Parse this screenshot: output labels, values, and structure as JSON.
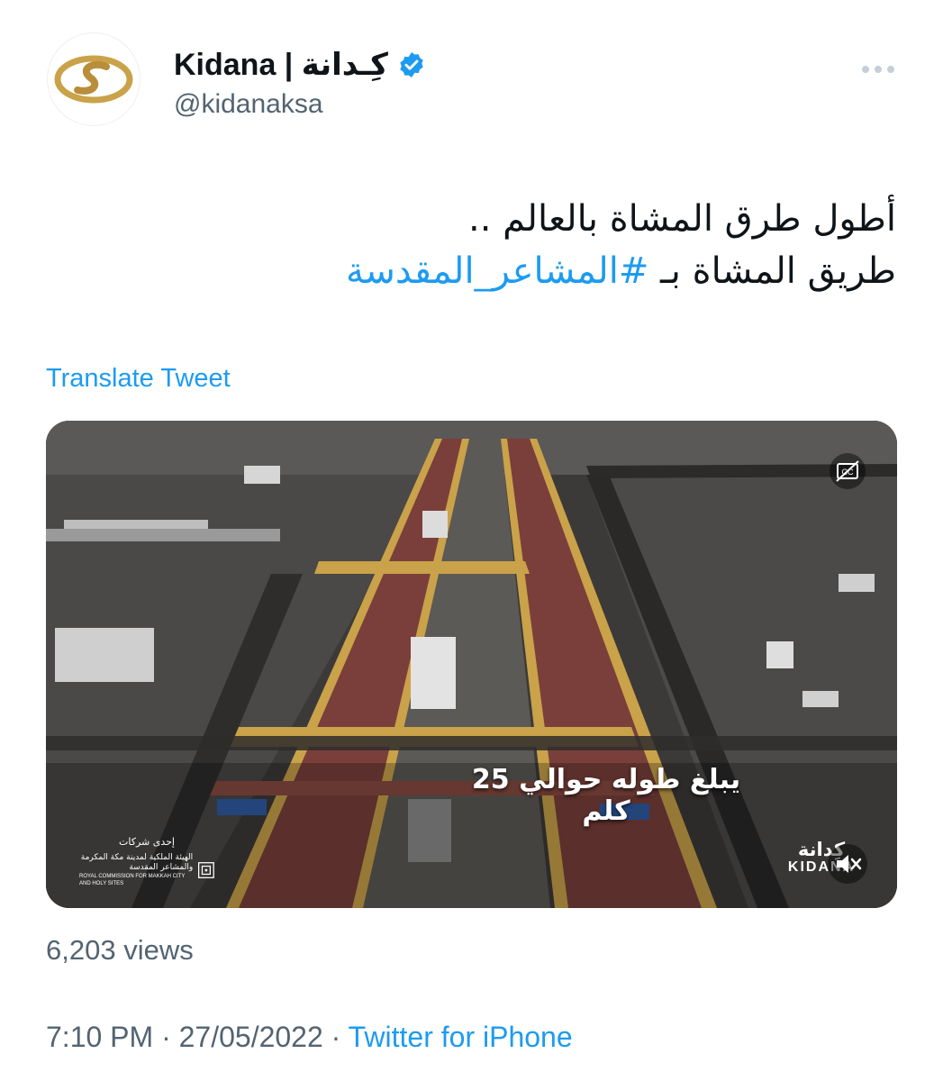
{
  "tweet": {
    "author": {
      "display_name": "Kidana | كِـدانة",
      "handle": "@kidanaksa",
      "verified": true,
      "avatar_icon": "kidana-logo-icon"
    },
    "more_icon": "more-dots-icon",
    "text_line1": "أطول طرق المشاة بالعالم ..",
    "text_line2_prefix": "طريق المشاة بـ ",
    "hashtag": "#المشاعر_المقدسة",
    "translate_label": "Translate Tweet",
    "media": {
      "type": "video",
      "caption": "يبلغ طوله حوالي 25 كلم",
      "brand_ar": "كِدانة",
      "brand_en": "KIDANA",
      "cc_icon": "closed-captions-icon",
      "mute_icon": "muted-speaker-icon",
      "commission_heading": "إحدى شركات",
      "commission_ar": "الهيئة الملكية لمدينة مكة المكرمة والمشاعر المقدسة",
      "commission_en": "ROYAL COMMISSION FOR MAKKAH CITY AND HOLY SITES"
    },
    "views": "6,203 views",
    "time": "7:10 PM",
    "date": "27/05/2022",
    "separator": " · ",
    "source": "Twitter for iPhone"
  },
  "colors": {
    "link": "#1d9bf0",
    "text": "#0f1419",
    "secondary": "#536471",
    "gold": "#c9a24a",
    "walkway": "#7a3f3a"
  }
}
